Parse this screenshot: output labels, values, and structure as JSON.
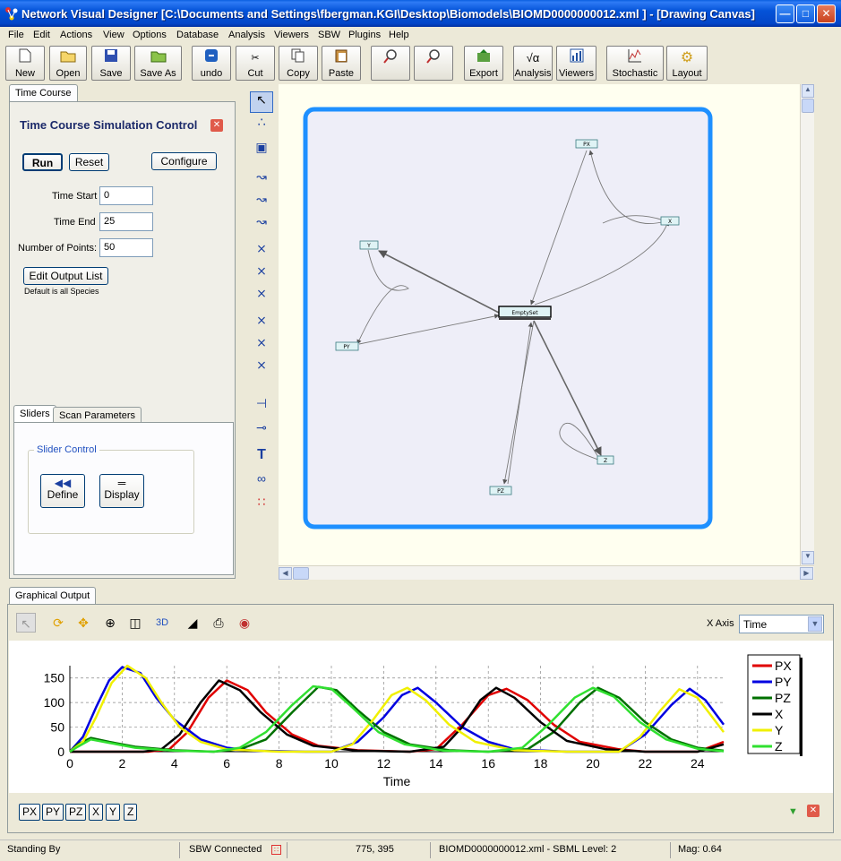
{
  "window": {
    "title": "Network Visual Designer [C:\\Documents and Settings\\fbergman.KGI\\Desktop\\Biomodels\\BIOMD0000000012.xml ] - [Drawing Canvas]"
  },
  "menu": [
    "File",
    "Edit",
    "Actions",
    "View",
    "Options",
    "Database",
    "Analysis",
    "Viewers",
    "SBW",
    "Plugins",
    "Help"
  ],
  "toolbar": {
    "new": "New",
    "open": "Open",
    "save": "Save",
    "save_as": "Save As",
    "undo": "undo",
    "cut": "Cut",
    "copy": "Copy",
    "paste": "Paste",
    "export": "Export",
    "analysis": "Analysis",
    "viewers": "Viewers",
    "stochastic": "Stochastic",
    "layout": "Layout"
  },
  "left_panel": {
    "tab": "Time Course",
    "heading": "Time Course Simulation Control",
    "run": "Run",
    "reset": "Reset",
    "configure": "Configure",
    "time_start_label": "Time Start",
    "time_start": "0",
    "time_end_label": "Time End",
    "time_end": "25",
    "points_label": "Number of Points:",
    "points": "50",
    "edit_output": "Edit Output List",
    "default_note": "Default is all Species",
    "tab_sliders": "Sliders",
    "tab_scan": "Scan Parameters",
    "slider_group": "Slider Control",
    "define": "Define",
    "display": "Display"
  },
  "network": {
    "nodes": [
      "PX",
      "X",
      "Y",
      "EmptySet",
      "PY",
      "Z",
      "PZ"
    ]
  },
  "graph_panel": {
    "tab": "Graphical Output",
    "x_axis_label": "X Axis",
    "x_axis_value": "Time",
    "three_d": "3D",
    "species_buttons": [
      "PX",
      "PY",
      "PZ",
      "X",
      "Y",
      "Z"
    ]
  },
  "chart_data": {
    "type": "line",
    "xlabel": "Time",
    "ylabel": "",
    "xlim": [
      0,
      25
    ],
    "ylim": [
      0,
      175
    ],
    "x_ticks": [
      0,
      2,
      4,
      6,
      8,
      10,
      12,
      14,
      16,
      18,
      20,
      22,
      24
    ],
    "y_ticks": [
      0,
      50,
      100,
      150
    ],
    "grid": true,
    "legend": "right",
    "series": [
      {
        "name": "PX",
        "color": "#e00000",
        "points": [
          [
            0,
            0
          ],
          [
            3,
            0
          ],
          [
            3.8,
            5
          ],
          [
            4.5,
            40
          ],
          [
            5.3,
            110
          ],
          [
            6,
            145
          ],
          [
            6.8,
            125
          ],
          [
            7.5,
            80
          ],
          [
            8.5,
            35
          ],
          [
            9.5,
            12
          ],
          [
            11,
            3
          ],
          [
            13,
            0
          ],
          [
            14,
            5
          ],
          [
            15,
            55
          ],
          [
            16,
            115
          ],
          [
            16.7,
            128
          ],
          [
            17.5,
            105
          ],
          [
            18.5,
            55
          ],
          [
            19.5,
            20
          ],
          [
            21,
            5
          ],
          [
            22,
            0
          ],
          [
            24,
            0
          ],
          [
            25,
            20
          ]
        ]
      },
      {
        "name": "PY",
        "color": "#0000e0",
        "points": [
          [
            0,
            0
          ],
          [
            0.5,
            30
          ],
          [
            1,
            90
          ],
          [
            1.5,
            145
          ],
          [
            2,
            172
          ],
          [
            2.7,
            160
          ],
          [
            3.3,
            110
          ],
          [
            4,
            65
          ],
          [
            5,
            25
          ],
          [
            6,
            8
          ],
          [
            7,
            2
          ],
          [
            9,
            0
          ],
          [
            10,
            0
          ],
          [
            11,
            20
          ],
          [
            12,
            70
          ],
          [
            12.7,
            115
          ],
          [
            13.3,
            130
          ],
          [
            14,
            100
          ],
          [
            15,
            50
          ],
          [
            16,
            20
          ],
          [
            17,
            5
          ],
          [
            19,
            0
          ],
          [
            21,
            0
          ],
          [
            22,
            35
          ],
          [
            23,
            95
          ],
          [
            23.7,
            128
          ],
          [
            24.3,
            105
          ],
          [
            25,
            55
          ]
        ]
      },
      {
        "name": "PZ",
        "color": "#007000",
        "points": [
          [
            0,
            0
          ],
          [
            0.3,
            15
          ],
          [
            0.8,
            28
          ],
          [
            1.5,
            20
          ],
          [
            2.5,
            10
          ],
          [
            4,
            3
          ],
          [
            5.5,
            0
          ],
          [
            6.5,
            5
          ],
          [
            7.5,
            25
          ],
          [
            8.5,
            80
          ],
          [
            9.5,
            132
          ],
          [
            10.2,
            125
          ],
          [
            11,
            85
          ],
          [
            12,
            40
          ],
          [
            13,
            15
          ],
          [
            14.5,
            3
          ],
          [
            16,
            0
          ],
          [
            17.5,
            5
          ],
          [
            18.5,
            40
          ],
          [
            19.5,
            100
          ],
          [
            20.2,
            130
          ],
          [
            21,
            110
          ],
          [
            22,
            60
          ],
          [
            23,
            25
          ],
          [
            24,
            8
          ],
          [
            25,
            2
          ]
        ]
      },
      {
        "name": "X",
        "color": "#000000",
        "points": [
          [
            0,
            0
          ],
          [
            2.8,
            0
          ],
          [
            3.5,
            5
          ],
          [
            4.2,
            35
          ],
          [
            5,
            100
          ],
          [
            5.7,
            145
          ],
          [
            6.5,
            125
          ],
          [
            7.3,
            80
          ],
          [
            8.3,
            35
          ],
          [
            9.3,
            12
          ],
          [
            11,
            2
          ],
          [
            13,
            0
          ],
          [
            14.3,
            10
          ],
          [
            15,
            50
          ],
          [
            15.7,
            105
          ],
          [
            16.3,
            130
          ],
          [
            17,
            110
          ],
          [
            18,
            60
          ],
          [
            19,
            22
          ],
          [
            20.5,
            5
          ],
          [
            22,
            0
          ],
          [
            24,
            0
          ],
          [
            25,
            15
          ]
        ]
      },
      {
        "name": "Y",
        "color": "#f0f000",
        "points": [
          [
            0,
            0
          ],
          [
            0.5,
            20
          ],
          [
            1,
            70
          ],
          [
            1.6,
            140
          ],
          [
            2.2,
            175
          ],
          [
            2.9,
            150
          ],
          [
            3.5,
            100
          ],
          [
            4.2,
            50
          ],
          [
            5,
            20
          ],
          [
            6,
            5
          ],
          [
            8,
            0
          ],
          [
            10,
            0
          ],
          [
            10.8,
            15
          ],
          [
            11.6,
            65
          ],
          [
            12.3,
            115
          ],
          [
            12.9,
            130
          ],
          [
            13.6,
            105
          ],
          [
            14.5,
            55
          ],
          [
            15.5,
            20
          ],
          [
            17,
            3
          ],
          [
            19,
            0
          ],
          [
            21,
            0
          ],
          [
            21.8,
            30
          ],
          [
            22.6,
            85
          ],
          [
            23.3,
            127
          ],
          [
            24,
            110
          ],
          [
            25,
            40
          ]
        ]
      },
      {
        "name": "Z",
        "color": "#30e030",
        "points": [
          [
            0,
            0
          ],
          [
            0.3,
            10
          ],
          [
            0.8,
            25
          ],
          [
            1.5,
            18
          ],
          [
            2.5,
            8
          ],
          [
            4,
            2
          ],
          [
            5.5,
            0
          ],
          [
            6.5,
            8
          ],
          [
            7.5,
            40
          ],
          [
            8.5,
            95
          ],
          [
            9.3,
            133
          ],
          [
            10,
            128
          ],
          [
            10.8,
            90
          ],
          [
            11.8,
            40
          ],
          [
            12.8,
            15
          ],
          [
            14.3,
            2
          ],
          [
            16,
            0
          ],
          [
            17.3,
            8
          ],
          [
            18.3,
            55
          ],
          [
            19.3,
            110
          ],
          [
            20,
            130
          ],
          [
            20.8,
            112
          ],
          [
            21.8,
            60
          ],
          [
            22.8,
            25
          ],
          [
            24,
            6
          ],
          [
            25,
            1
          ]
        ]
      }
    ]
  },
  "status": {
    "state": "Standing By",
    "sbw": "SBW Connected",
    "coords": "775, 395",
    "file": "BIOMD0000000012.xml - SBML Level: 2",
    "mag": "Mag: 0.64"
  }
}
